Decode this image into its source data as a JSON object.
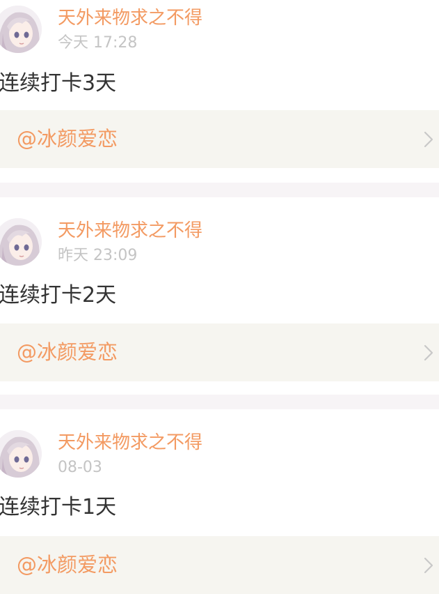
{
  "posts": [
    {
      "author": "天外来物求之不得",
      "time": "今天 17:28",
      "content": "连续打卡3天",
      "mention": "@冰颜爱恋",
      "avatar_icon": "anime-girl-avatar",
      "chevron_icon": "chevron-right-icon"
    },
    {
      "author": "天外来物求之不得",
      "time": "昨天 23:09",
      "content": "连续打卡2天",
      "mention": "@冰颜爱恋",
      "avatar_icon": "anime-girl-avatar",
      "chevron_icon": "chevron-right-icon"
    },
    {
      "author": "天外来物求之不得",
      "time": "08-03",
      "content": "连续打卡1天",
      "mention": "@冰颜爱恋",
      "avatar_icon": "anime-girl-avatar",
      "chevron_icon": "chevron-right-icon"
    }
  ],
  "colors": {
    "author": "#f39a62",
    "mention": "#f39a62",
    "time": "#c4c4c4",
    "content": "#333333",
    "card_background": "#f6f5f0",
    "separator": "#f7f4f6"
  }
}
